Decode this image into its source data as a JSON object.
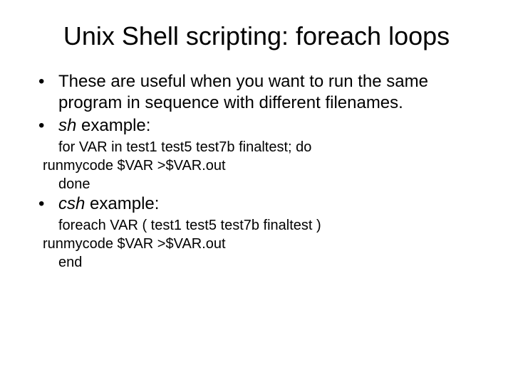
{
  "title": "Unix Shell scripting: foreach loops",
  "bullets": {
    "intro": "These are useful when you want to run the same program in sequence with different filenames.",
    "sh_label_prefix": "sh",
    "sh_label_rest": " example:",
    "csh_label_prefix": "csh",
    "csh_label_rest": " example:"
  },
  "sh": {
    "line1": "for VAR in test1 test5 test7b finaltest; do",
    "line2": "runmycode $VAR >$VAR.out",
    "line3": "done"
  },
  "csh": {
    "line1": "foreach VAR ( test1 test5 test7b finaltest )",
    "line2": "runmycode $VAR >$VAR.out",
    "line3": "end"
  }
}
